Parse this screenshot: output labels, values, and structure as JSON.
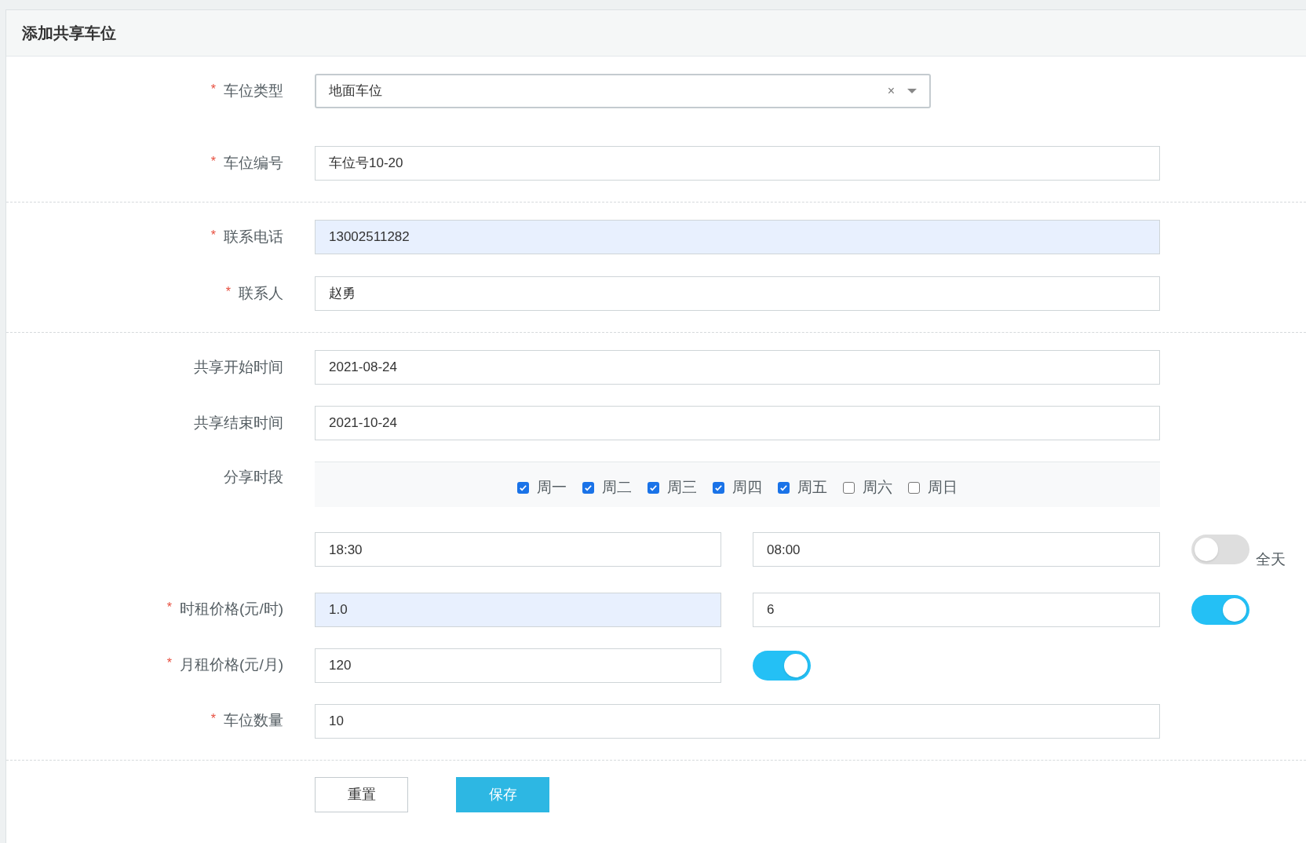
{
  "title": "添加共享车位",
  "groups": [
    [
      {
        "kind": "select",
        "label": "车位类型",
        "mark": "*",
        "value": "地面车位",
        "clear": "×"
      },
      {
        "kind": "input",
        "label": "车位编号",
        "mark": "*",
        "value": "车位号10-20",
        "highlighted": false
      }
    ],
    [
      {
        "kind": "input",
        "label": "联系电话",
        "mark": "*",
        "value": "13002511282",
        "highlighted": true
      },
      {
        "kind": "input",
        "label": "联系人",
        "mark": "*",
        "value": "赵勇",
        "highlighted": false
      }
    ],
    [
      {
        "kind": "input",
        "label": "共享开始时间",
        "value": "2021-08-24",
        "highlighted": false
      },
      {
        "kind": "input",
        "label": "共享结束时间",
        "value": "2021-10-24",
        "highlighted": false
      },
      {
        "kind": "weekdays",
        "label": "分享时段",
        "days": [
          {
            "label": "周一",
            "checked": true
          },
          {
            "label": "周二",
            "checked": true
          },
          {
            "label": "周三",
            "checked": true
          },
          {
            "label": "周四",
            "checked": true
          },
          {
            "label": "周五",
            "checked": true
          },
          {
            "label": "周六",
            "checked": false
          },
          {
            "label": "周日",
            "checked": false
          }
        ]
      },
      {
        "kind": "time_range",
        "start": "18:30",
        "end": "08:00",
        "toggle_on": false,
        "toggle_label": "全天"
      },
      {
        "kind": "pair",
        "label": "时租价格(元/时)",
        "mark": "*",
        "value": "1.0",
        "highlighted": true,
        "value2": "6",
        "toggle_on": true
      },
      {
        "kind": "input_toggle",
        "label": "月租价格(元/月)",
        "mark": "*",
        "value": "120",
        "highlighted": false,
        "toggle_on": true
      },
      {
        "kind": "input",
        "label": "车位数量",
        "mark": "*",
        "value": "10",
        "highlighted": false
      }
    ]
  ],
  "buttons": [
    {
      "kind": "reset",
      "label": "重置"
    },
    {
      "kind": "save",
      "label": "保存"
    }
  ]
}
